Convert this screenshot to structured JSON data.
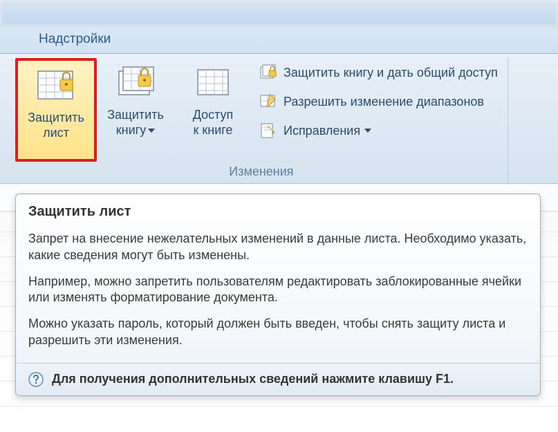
{
  "tabs": {
    "addins": "Надстройки"
  },
  "ribbon": {
    "group_caption": "Изменения",
    "protect_sheet": {
      "line1": "Защитить",
      "line2": "лист"
    },
    "protect_workbook": {
      "line1": "Защитить",
      "line2": "книгу"
    },
    "share_workbook": {
      "line1": "Доступ",
      "line2": "к книге"
    },
    "protect_share": "Защитить книгу и дать общий доступ",
    "allow_ranges": "Разрешить изменение диапазонов",
    "track_changes": "Исправления"
  },
  "tooltip": {
    "title": "Защитить лист",
    "p1": "Запрет на внесение нежелательных изменений в данные листа. Необходимо указать, какие сведения могут быть изменены.",
    "p2": "Например, можно запретить пользователям редактировать заблокированные ячейки или изменять форматирование документа.",
    "p3": "Можно указать пароль, который должен быть введен, чтобы снять защиту листа и разрешить эти изменения.",
    "footer": "Для получения дополнительных сведений нажмите клавишу F1."
  }
}
